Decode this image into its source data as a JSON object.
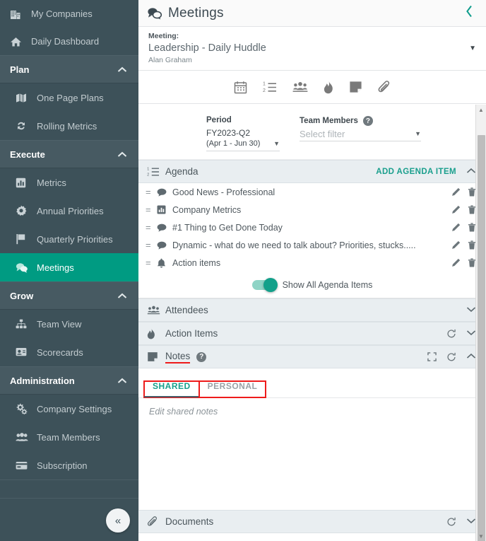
{
  "sidebar": {
    "top_items": [
      {
        "label": "My Companies",
        "icon": "building-icon"
      },
      {
        "label": "Daily Dashboard",
        "icon": "home-icon"
      }
    ],
    "sections": [
      {
        "label": "Plan",
        "items": [
          {
            "label": "One Page Plans",
            "icon": "map-icon"
          },
          {
            "label": "Rolling Metrics",
            "icon": "refresh-icon"
          }
        ]
      },
      {
        "label": "Execute",
        "items": [
          {
            "label": "Metrics",
            "icon": "bar-chart-icon"
          },
          {
            "label": "Annual Priorities",
            "icon": "badge-icon"
          },
          {
            "label": "Quarterly Priorities",
            "icon": "flag-icon"
          },
          {
            "label": "Meetings",
            "icon": "chat-bubbles-icon",
            "active": true
          }
        ]
      },
      {
        "label": "Grow",
        "items": [
          {
            "label": "Team View",
            "icon": "org-chart-icon"
          },
          {
            "label": "Scorecards",
            "icon": "scorecard-icon"
          }
        ]
      },
      {
        "label": "Administration",
        "items": [
          {
            "label": "Company Settings",
            "icon": "gears-icon"
          },
          {
            "label": "Team Members",
            "icon": "people-icon"
          },
          {
            "label": "Subscription",
            "icon": "credit-card-icon"
          }
        ]
      }
    ],
    "collapse_label": "«"
  },
  "header": {
    "title": "Meetings",
    "icon": "chat-bubbles-icon",
    "back_icon": "chevron-left-icon"
  },
  "meeting": {
    "label": "Meeting:",
    "name": "Leadership - Daily Huddle",
    "owner": "Alan Graham",
    "caret_icon": "chevron-down-icon"
  },
  "toolbar": {
    "items": [
      {
        "icon": "calendar-icon",
        "name": "calendar"
      },
      {
        "icon": "numbered-list-icon",
        "name": "agenda"
      },
      {
        "icon": "attendees-icon",
        "name": "attendees"
      },
      {
        "icon": "flame-icon",
        "name": "action-items"
      },
      {
        "icon": "note-icon",
        "name": "notes"
      },
      {
        "icon": "paperclip-icon",
        "name": "documents"
      }
    ]
  },
  "filters": {
    "period": {
      "label": "Period",
      "value": "FY2023-Q2",
      "sub": "(Apr 1 - Jun 30)"
    },
    "team_members": {
      "label": "Team Members",
      "placeholder": "Select filter",
      "help_icon": "question-icon",
      "help_char": "?"
    }
  },
  "agenda": {
    "title": "Agenda",
    "icon": "numbered-list-icon",
    "add_label": "ADD AGENDA ITEM",
    "chevron": "⌃",
    "items": [
      {
        "text": "Good News - Professional",
        "icon": "chat-icon"
      },
      {
        "text": "Company Metrics",
        "icon": "bar-chart-icon"
      },
      {
        "text": "#1 Thing to Get Done Today",
        "icon": "chat-icon"
      },
      {
        "text": "Dynamic - what do we need to talk about? Priorities, stucks.....",
        "icon": "chat-icon"
      },
      {
        "text": "Action items",
        "icon": "bell-icon"
      }
    ],
    "toggle_label": "Show All Agenda Items",
    "toggle_on": true
  },
  "sections": {
    "attendees": {
      "title": "Attendees",
      "icon": "attendees-icon"
    },
    "action_items": {
      "title": "Action Items",
      "icon": "flame-icon"
    },
    "notes": {
      "title": "Notes",
      "icon": "note-icon",
      "help_char": "?"
    },
    "documents": {
      "title": "Documents",
      "icon": "paperclip-icon"
    }
  },
  "notes": {
    "tabs": [
      {
        "label": "SHARED",
        "active": true
      },
      {
        "label": "PERSONAL",
        "active": false
      }
    ],
    "placeholder": "Edit shared notes"
  },
  "colors": {
    "accent_teal": "#009b82",
    "sidebar_bg": "#3d5159",
    "sidebar_section_bg": "#475a62",
    "annotation_red": "#ee1b1b",
    "section_header_bg": "#e9eef1"
  }
}
